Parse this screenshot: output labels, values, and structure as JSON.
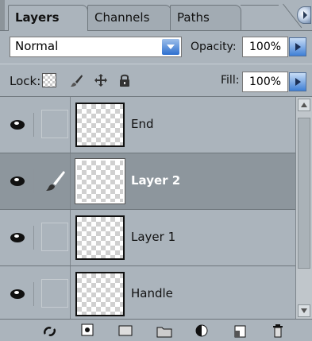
{
  "tabs": [
    {
      "label": "Layers",
      "active": true
    },
    {
      "label": "Channels",
      "active": false
    },
    {
      "label": "Paths",
      "active": false
    }
  ],
  "panel_menu_icon": "panel-menu-arrow-icon",
  "blend_mode": {
    "value": "Normal"
  },
  "opacity": {
    "label": "Opacity:",
    "value": "100%"
  },
  "lock": {
    "label": "Lock:",
    "icons": [
      "lock-transparent-pixels-icon",
      "lock-image-pixels-brush-icon",
      "lock-position-move-icon",
      "lock-all-padlock-icon"
    ]
  },
  "fill": {
    "label": "Fill:",
    "value": "100%"
  },
  "layers": [
    {
      "name": "End",
      "visible": true,
      "selected": false,
      "linked_brush": false
    },
    {
      "name": "Layer 2",
      "visible": true,
      "selected": true,
      "linked_brush": true
    },
    {
      "name": "Layer 1",
      "visible": true,
      "selected": false,
      "linked_brush": false
    },
    {
      "name": "Handle",
      "visible": true,
      "selected": false,
      "linked_brush": false
    }
  ],
  "bottom_icons": [
    "link-layers-icon",
    "add-layer-style-icon",
    "add-layer-mask-icon",
    "create-group-folder-icon",
    "adjustment-layer-icon",
    "new-layer-icon",
    "delete-layer-trash-icon"
  ],
  "colors": {
    "panel_bg": "#ABB4BC",
    "selected_row": "#8D969D",
    "accent_blue": "#3F7FD6"
  }
}
